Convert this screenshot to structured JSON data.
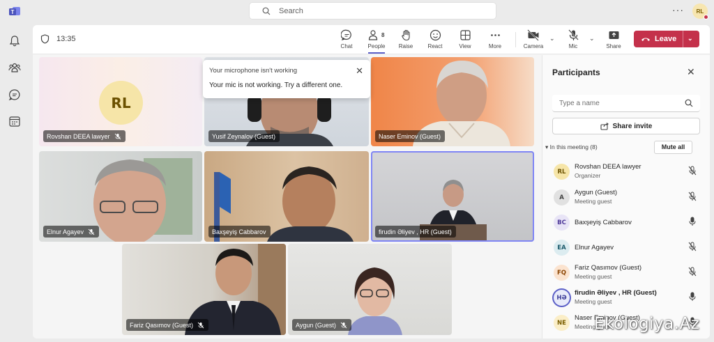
{
  "search": {
    "placeholder": "Search"
  },
  "user": {
    "initials": "RL"
  },
  "meeting": {
    "timer": "13:35",
    "controls": [
      {
        "label": "Chat",
        "icon": "chat-icon"
      },
      {
        "label": "People",
        "icon": "people-icon",
        "badge": "8"
      },
      {
        "label": "Raise",
        "icon": "raise-hand-icon"
      },
      {
        "label": "React",
        "icon": "react-icon"
      },
      {
        "label": "View",
        "icon": "view-icon"
      },
      {
        "label": "More",
        "icon": "more-icon"
      },
      {
        "label": "Camera",
        "icon": "camera-off-icon"
      },
      {
        "label": "Mic",
        "icon": "mic-off-icon"
      },
      {
        "label": "Share",
        "icon": "share-icon"
      }
    ],
    "leave_label": "Leave"
  },
  "tiles": [
    {
      "name": "Rovshan DEEA lawyer",
      "initials": "RL",
      "muted": true
    },
    {
      "name": "Yusif Zeynalov (Guest)",
      "muted": false
    },
    {
      "name": "Naser Eminov (Guest)",
      "muted": false
    },
    {
      "name": "Elnur Agayev",
      "muted": true
    },
    {
      "name": "Baxşeyiş Cabbarov",
      "muted": false
    },
    {
      "name": "firudin Əliyev , HR (Guest)",
      "muted": false
    },
    {
      "name": "Fariz Qasımov (Guest)",
      "muted": true
    },
    {
      "name": "Aygun (Guest)",
      "muted": true
    }
  ],
  "toast": {
    "title": "Your microphone isn't working",
    "message": "Your mic is not working. Try a different one."
  },
  "participants": {
    "title": "Participants",
    "search_placeholder": "Type a name",
    "share_invite": "Share invite",
    "in_meeting": "In this meeting (8)",
    "mute_all": "Mute all",
    "list": [
      {
        "initials": "RL",
        "name": "Rovshan DEEA lawyer",
        "role": "Organizer",
        "mic": "off",
        "color": "#f6e5a8",
        "fg": "#6b5100"
      },
      {
        "initials": "A",
        "name": "Aygun (Guest)",
        "role": "Meeting guest",
        "mic": "off",
        "color": "#e1e1e1",
        "fg": "#424242"
      },
      {
        "initials": "BC",
        "name": "Baxşeyiş Cabbarov",
        "role": "",
        "mic": "on",
        "color": "#e8e4f6",
        "fg": "#4f3a99"
      },
      {
        "initials": "EA",
        "name": "Elnur Agayev",
        "role": "",
        "mic": "off",
        "color": "#dcecf0",
        "fg": "#1b5a6b"
      },
      {
        "initials": "FQ",
        "name": "Fariz Qasımov (Guest)",
        "role": "Meeting guest",
        "mic": "off",
        "color": "#fbe3cf",
        "fg": "#8a4300"
      },
      {
        "initials": "HƏ",
        "name": "firudin Əliyev , HR (Guest)",
        "role": "Meeting guest",
        "mic": "on",
        "color": "#e8ebfa",
        "fg": "#3d3e99",
        "speaking": true
      },
      {
        "initials": "NE",
        "name": "Naser Eminov (Guest)",
        "role": "Meeting guest",
        "mic": "on",
        "color": "#fbeec7",
        "fg": "#7a5d00"
      }
    ]
  },
  "watermark": "Ekologiya.Az"
}
